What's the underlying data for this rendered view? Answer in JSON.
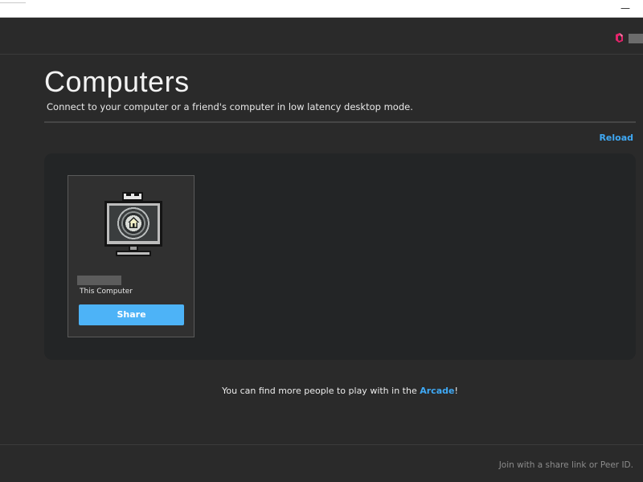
{
  "titlebar": {
    "minimize_label": "—"
  },
  "header": {
    "logo_icon": "app-logo-icon",
    "accent_color": "#e5246b"
  },
  "page": {
    "title": "Computers",
    "subtitle": "Connect to your computer or a friend's computer in low latency desktop mode.",
    "reload_label": "Reload"
  },
  "computers": [
    {
      "icon": "home-computer-icon",
      "badge_icon": "crown-icon",
      "subtitle": "This Computer",
      "share_label": "Share"
    }
  ],
  "footer": {
    "text_before": "You can find more people to play with in the ",
    "link_label": "Arcade",
    "text_after": "!",
    "join_placeholder": "Join with a share link or Peer ID."
  },
  "colors": {
    "background": "#2a2a2a",
    "panel": "#232526",
    "card": "#303030",
    "link": "#3fa9f5",
    "button": "#4db3f7"
  }
}
